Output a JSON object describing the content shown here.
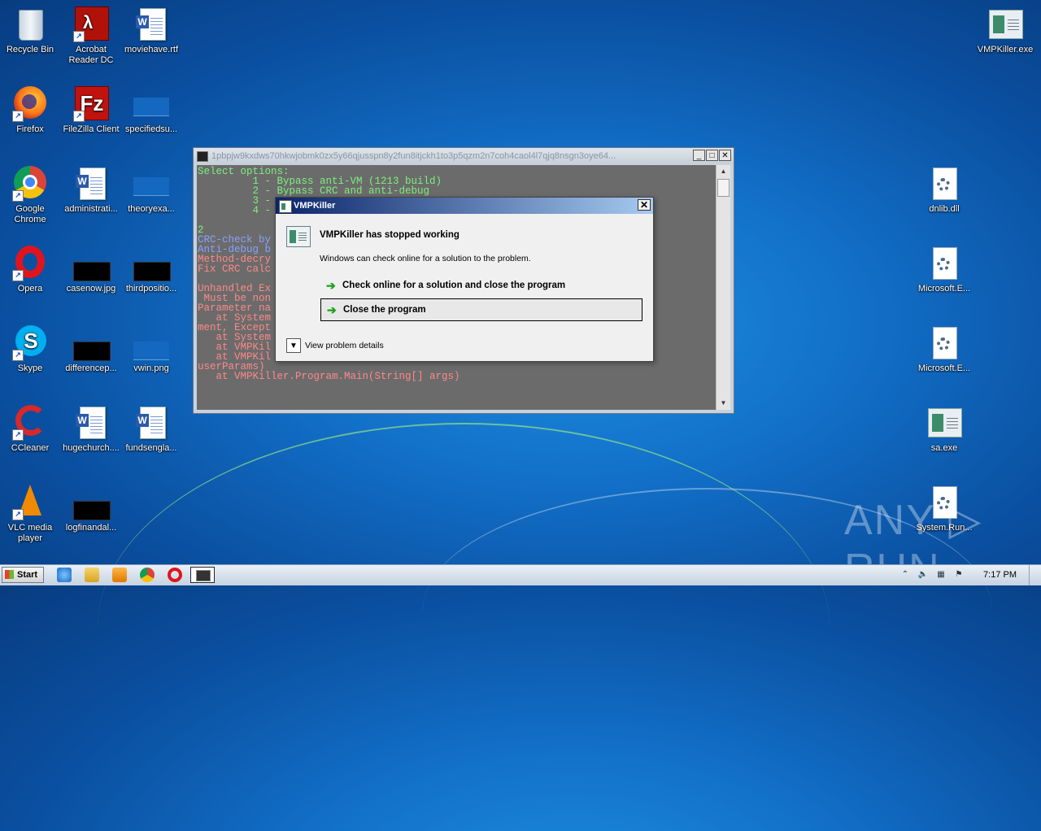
{
  "desktop": {
    "icons": [
      {
        "label": "Recycle Bin"
      },
      {
        "label": "Acrobat Reader DC"
      },
      {
        "label": "moviehave.rtf"
      },
      {
        "label": "Firefox"
      },
      {
        "label": "FileZilla Client"
      },
      {
        "label": "specifiedsu..."
      },
      {
        "label": "Google Chrome"
      },
      {
        "label": "administrati..."
      },
      {
        "label": "theoryexa..."
      },
      {
        "label": "Opera"
      },
      {
        "label": "casenow.jpg"
      },
      {
        "label": "thirdpositio..."
      },
      {
        "label": "Skype"
      },
      {
        "label": "differencep..."
      },
      {
        "label": "vwin.png"
      },
      {
        "label": "CCleaner"
      },
      {
        "label": "hugechurch...."
      },
      {
        "label": "fundsengla..."
      },
      {
        "label": "VLC media player"
      },
      {
        "label": "logfinandal..."
      },
      {
        "label": "VMPKiller.exe"
      },
      {
        "label": "dnlib.dll"
      },
      {
        "label": "Microsoft.E..."
      },
      {
        "label": "Microsoft.E..."
      },
      {
        "label": "sa.exe"
      },
      {
        "label": "System.Run..."
      }
    ]
  },
  "console": {
    "title": "1pbpjw9kxdws70hkwjobmk0zx5y66qjusspn8y2fun8itjckh1to3p5qzm2n7coh4caol4l7qjq8nsgn3oye64...",
    "lines": [
      {
        "text": "Select options:",
        "color": "#7cf07c"
      },
      {
        "text": "         1 - Bypass anti-VM (1213 build)",
        "color": "#7cf07c"
      },
      {
        "text": "         2 - Bypass CRC and anti-debug",
        "color": "#7cf07c"
      },
      {
        "text": "         3 -",
        "color": "#7cf07c"
      },
      {
        "text": "         4 -",
        "color": "#7cf07c"
      },
      {
        "text": "",
        "color": "#7cf07c"
      },
      {
        "text": "2",
        "color": "#7cf07c"
      },
      {
        "text": "CRC-check by",
        "color": "#8aa0ff"
      },
      {
        "text": "Anti-debug b",
        "color": "#8aa0ff"
      },
      {
        "text": "Method-decry",
        "color": "#f88"
      },
      {
        "text": "Fix CRC calc",
        "color": "#f88"
      },
      {
        "text": "",
        "color": "#f88"
      },
      {
        "text": "Unhandled Ex                                                    of range.",
        "color": "#f88"
      },
      {
        "text": " Must be non",
        "color": "#f88"
      },
      {
        "text": "Parameter na",
        "color": "#f88"
      },
      {
        "text": "   at System                                                  ument argu",
        "color": "#f88"
      },
      {
        "text": "ment, Except",
        "color": "#f88"
      },
      {
        "text": "   at System",
        "color": "#f88"
      },
      {
        "text": "   at VMPKil",
        "color": "#f88"
      },
      {
        "text": "   at VMPKil                                                 le, Int32",
        "color": "#f88"
      },
      {
        "text": "userParams)",
        "color": "#f88"
      },
      {
        "text": "   at VMPKiller.Program.Main(String[] args)",
        "color": "#f88"
      }
    ]
  },
  "dialog": {
    "title": "VMPKiller",
    "heading": "VMPKiller has stopped working",
    "subtext": "Windows can check online for a solution to the problem.",
    "option1": "Check online for a solution and close the program",
    "option2": "Close the program",
    "details": "View problem details"
  },
  "watermark": "ANY ▷ RUN",
  "taskbar": {
    "start_label": "Start",
    "clock": "7:17 PM"
  }
}
